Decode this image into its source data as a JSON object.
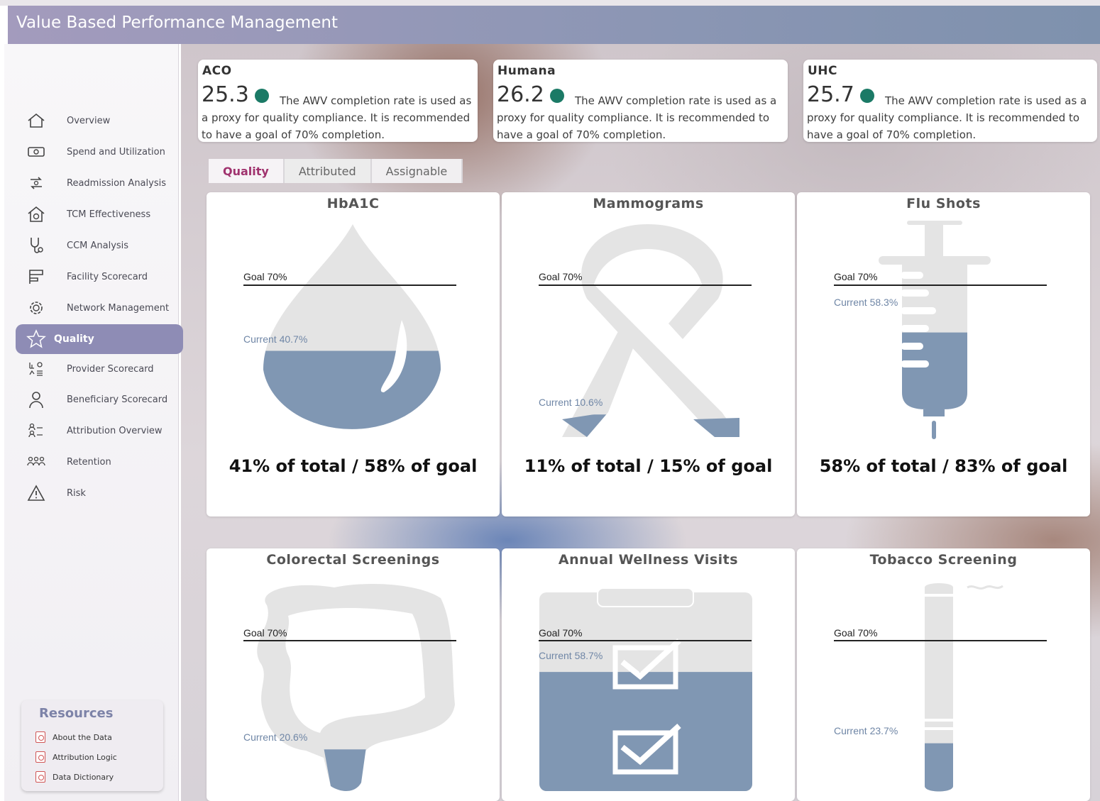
{
  "app": {
    "title": "Value Based Performance Management"
  },
  "sidebar": {
    "items": [
      {
        "label": "Overview",
        "icon": "home-icon"
      },
      {
        "label": "Spend and Utilization",
        "icon": "money-icon"
      },
      {
        "label": "Readmission Analysis",
        "icon": "readmission-icon"
      },
      {
        "label": "TCM Effectiveness",
        "icon": "house-gear-icon"
      },
      {
        "label": "CCM Analysis",
        "icon": "stethoscope-icon"
      },
      {
        "label": "Facility Scorecard",
        "icon": "facility-icon"
      },
      {
        "label": "Network Management",
        "icon": "gear-icon"
      },
      {
        "label": "Quality",
        "icon": "star-icon",
        "active": true
      },
      {
        "label": "Provider Scorecard",
        "icon": "scorecard-icon"
      },
      {
        "label": "Beneficiary Scorecard",
        "icon": "person-icon"
      },
      {
        "label": "Attribution Overview",
        "icon": "attribution-icon"
      },
      {
        "label": "Retention",
        "icon": "people-icon"
      },
      {
        "label": "Risk",
        "icon": "warning-icon"
      }
    ],
    "resources": {
      "title": "Resources",
      "items": [
        "About the Data",
        "Attribution Logic",
        "Data Dictionary"
      ]
    }
  },
  "kpis": [
    {
      "name": "ACO",
      "value": "25.3",
      "desc": "The AWV completion rate is used as a proxy for quality compliance. It is recommended to have a goal of 70% completion.",
      "status_color": "#1b7a66"
    },
    {
      "name": "Humana",
      "value": "26.2",
      "desc": "The AWV completion rate is used as a proxy for quality compliance. It is recommended to have a goal of 70% completion.",
      "status_color": "#1b7a66"
    },
    {
      "name": "UHC",
      "value": "25.7",
      "desc": "The AWV completion rate is used as a proxy for quality compliance. It is recommended to have a goal of 70% completion.",
      "status_color": "#1b7a66"
    }
  ],
  "tabs": [
    {
      "label": "Quality",
      "active": true
    },
    {
      "label": "Attributed"
    },
    {
      "label": "Assignable"
    }
  ],
  "metrics": [
    {
      "title": "HbA1C",
      "goal_label": "Goal 70%",
      "current_label": "Current 40.7%",
      "current": 40.7,
      "summary": "41% of total / 58% of goal",
      "shape": "drop-icon"
    },
    {
      "title": "Mammograms",
      "goal_label": "Goal 70%",
      "current_label": "Current 10.6%",
      "current": 10.6,
      "summary": "11% of total / 15% of goal",
      "shape": "ribbon-icon"
    },
    {
      "title": "Flu Shots",
      "goal_label": "Goal 70%",
      "current_label": "Current 58.3%",
      "current": 58.3,
      "summary": "58% of total / 83% of goal",
      "shape": "syringe-icon"
    },
    {
      "title": "Colorectal Screenings",
      "goal_label": "Goal 70%",
      "current_label": "Current 20.6%",
      "current": 20.6,
      "summary": "",
      "shape": "colon-icon"
    },
    {
      "title": "Annual Wellness Visits",
      "goal_label": "Goal 70%",
      "current_label": "Current 58.7%",
      "current": 58.7,
      "summary": "",
      "shape": "clipboard-icon"
    },
    {
      "title": "Tobacco Screening",
      "goal_label": "Goal 70%",
      "current_label": "Current 23.7%",
      "current": 23.7,
      "summary": "",
      "shape": "cigarette-icon"
    }
  ],
  "colors": {
    "fill": "#8097b3",
    "empty": "#e4e4e4",
    "accent": "#8e8cb5",
    "active_tab": "#a0326e"
  }
}
